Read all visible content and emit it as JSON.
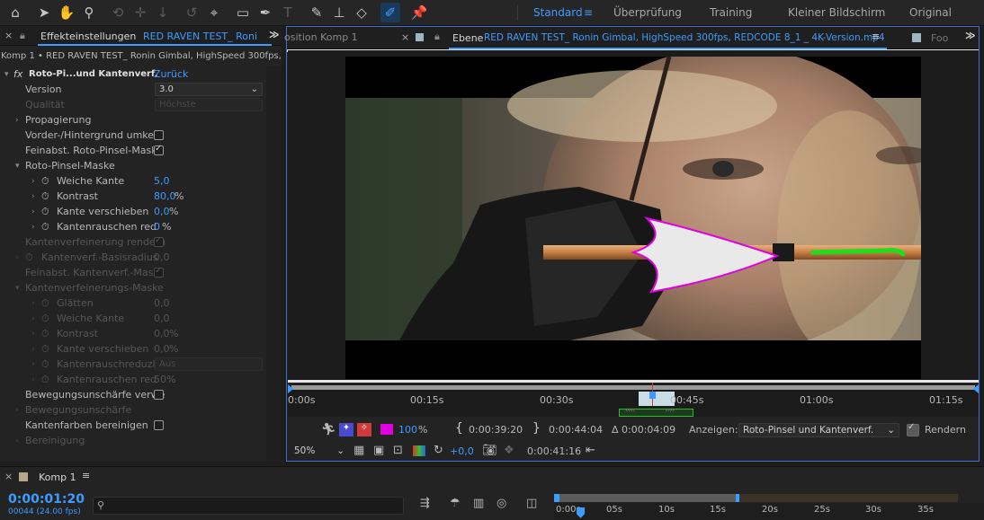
{
  "toolbar": {
    "workspaces": [
      "Standard",
      "Überprüfung",
      "Training",
      "Kleiner Bildschirm",
      "Original"
    ],
    "active_workspace": "Standard",
    "menu_icon": "hamburger-icon"
  },
  "effects": {
    "tab_title": "Effekteinstellungen",
    "tab_layer": "RED RAVEN TEST_ Roni",
    "breadcrumb": "Komp 1 • RED RAVEN TEST_ Ronin Gimbal, HighSpeed 300fps, R",
    "effect_name": "Roto-Pi...und Kantenverf.",
    "reset_label": "Zurück",
    "version_label": "Version",
    "version_value": "3.0",
    "quality_label": "Qualität",
    "quality_value": "Höchste",
    "propagation_label": "Propagierung",
    "fg_bg_label": "Vorder-/Hintergrund umkeh",
    "fine_roto_label": "Feinabst. Roto-Pinsel-Mask",
    "roto_mask_label": "Roto-Pinsel-Maske",
    "soft_edge_label": "Weiche Kante",
    "soft_edge_value": "5,0",
    "contrast_label": "Kontrast",
    "contrast_value": "80,0",
    "contrast_unit": "%",
    "shift_edge_label": "Kante verschieben",
    "shift_edge_value": "0,0",
    "shift_edge_unit": "%",
    "chatter_label": "Kantenrauschen red",
    "chatter_value": "0",
    "chatter_unit": "%",
    "refine_render_label": "Kantenverfeinerung rendern",
    "refine_radius_label": "Kantenverf.-Basisradius",
    "refine_radius_value": "0,0",
    "fine_refine_label": "Feinabst. Kantenverf.-Mask",
    "refine_mask_label": "Kantenverfeinerungs-Maske",
    "smooth_label": "Glätten",
    "smooth_value": "0,0",
    "d_soft_edge_label": "Weiche Kante",
    "d_soft_edge_value": "0,0",
    "d_contrast_label": "Kontrast",
    "d_contrast_value": "0,0",
    "d_contrast_unit": "%",
    "d_shift_label": "Kante verschieben",
    "d_shift_value": "0,0",
    "d_shift_unit": "%",
    "d_reduce_label": "Kantenrauschreduzi",
    "d_reduce_value": "Aus",
    "d_chatter_label": "Kantenrauschen red",
    "d_chatter_value": "50",
    "d_chatter_unit": "%",
    "motion_blur_label": "Bewegungsunschärfe verwe",
    "motion_blur2_label": "Bewegungsunschärfe",
    "decontam_label": "Kantenfarben bereinigen",
    "cleanup_label": "Bereinigung"
  },
  "viewer": {
    "tab_comp_label": "osition Komp 1",
    "tab_layer_prefix": "Ebene",
    "tab_layer_name": "RED RAVEN TEST_ Ronin Gimbal, HighSpeed 300fps, REDCODE 8_1 _ 4K-Version.mp4",
    "tab_foot_label": "Foo",
    "ruler_labels": [
      "0:00s",
      "00:15s",
      "00:30s",
      "00:45s",
      "01:00s",
      "01:15s"
    ],
    "opacity_value": "100",
    "opacity_unit": "%",
    "in_point": "0:00:39:20",
    "out_point": "0:00:44:04",
    "duration": "Δ 0:00:04:09",
    "show_label": "Anzeigen:",
    "show_value": "Roto-Pinsel und Kantenverf.",
    "render_label": "Rendern",
    "zoom_value": "50%",
    "exposure_value": "+0,0",
    "timecode": "0:00:41:16",
    "accent_color": "#3d9cff",
    "mask_color": "#e000e0"
  },
  "timeline": {
    "comp_tab": "Komp 1",
    "current_time": "0:00:01:20",
    "frame_info": "00044 (24.00 fps)",
    "search_placeholder": "",
    "ruler_labels": [
      "0:00s",
      "05s",
      "10s",
      "15s",
      "20s",
      "25s",
      "30s",
      "35s"
    ]
  }
}
